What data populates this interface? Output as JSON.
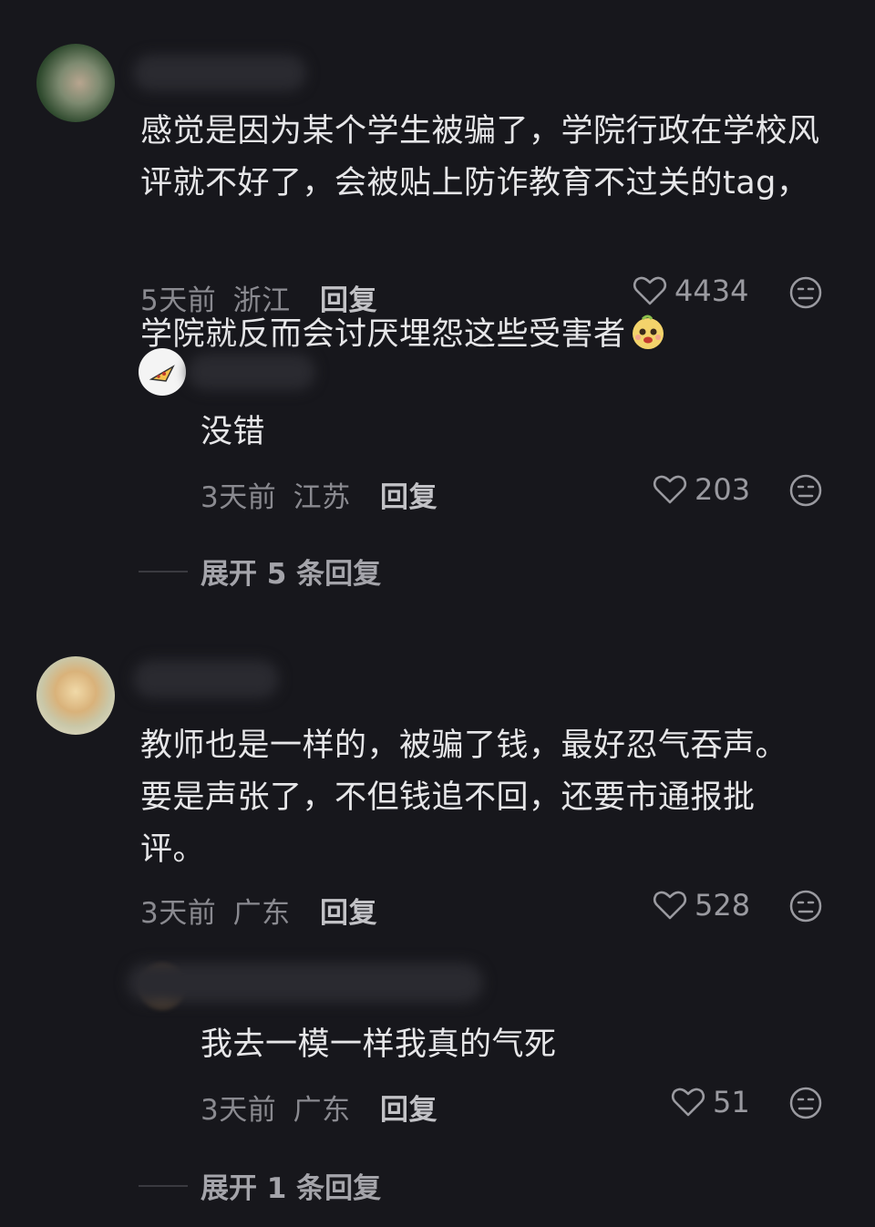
{
  "comments": [
    {
      "text": "感觉是因为某个学生被骗了，学院行政在学校风评就不好了，会被贴上防诈教育不过关的tag，学院就反而会讨厌埋怨这些受害者",
      "time": "5天前",
      "location": "浙江",
      "reply_label": "回复",
      "likes": "4434",
      "replies": [
        {
          "text": "没错",
          "time": "3天前",
          "location": "江苏",
          "reply_label": "回复",
          "likes": "203"
        }
      ],
      "expand_label": "展开 5 条回复"
    },
    {
      "text": "教师也是一样的，被骗了钱，最好忍气吞声。要是声张了，不但钱追不回，还要市通报批评。",
      "time": "3天前",
      "location": "广东",
      "reply_label": "回复",
      "likes": "528",
      "replies": [
        {
          "text": "我去一模一样我真的气死",
          "time": "3天前",
          "location": "广东",
          "reply_label": "回复",
          "likes": "51"
        }
      ],
      "expand_label": "展开 1 条回复"
    }
  ],
  "icons": {
    "like": "heart-outline-icon",
    "dislike": "meh-face-icon",
    "emoji": "smiley-emoji"
  }
}
